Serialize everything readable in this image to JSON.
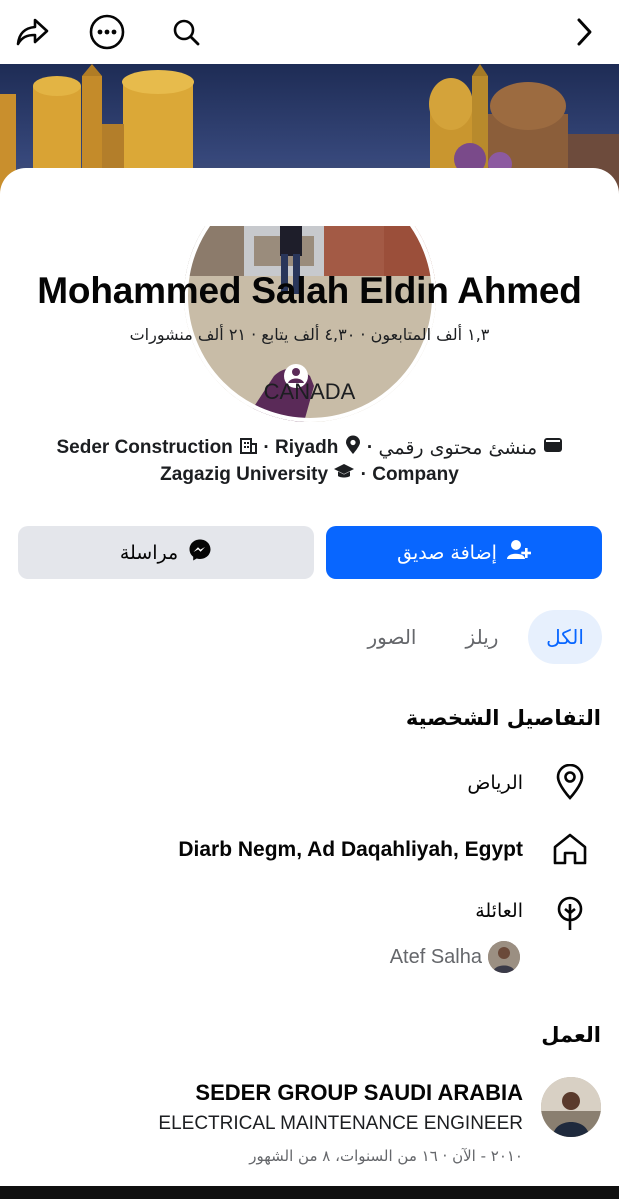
{
  "toolbar": {
    "share_icon": "share-icon",
    "more_icon": "more-dots-icon",
    "search_icon": "search-icon",
    "forward_icon": "chevron-right-icon"
  },
  "profile": {
    "name": "Mohammed Salah Eldin Ahmed",
    "stats": "١,٣ ألف المتابعون · ٤,٣٠ ألف يتابع · ٢١ ألف منشورات",
    "bio": "CANADA",
    "meta_line1": {
      "category": "منشئ محتوى رقمي",
      "location": "Riyadh",
      "workplace": "Seder Construction"
    },
    "meta_line2": {
      "education": "Zagazig University",
      "company": "Company"
    }
  },
  "actions": {
    "add_friend": "إضافة صديق",
    "message": "مراسلة"
  },
  "tabs": [
    {
      "label": "الكل",
      "active": true
    },
    {
      "label": "ريلز",
      "active": false
    },
    {
      "label": "الصور",
      "active": false
    }
  ],
  "details": {
    "title": "التفاصيل الشخصية",
    "current_city": "الرياض",
    "hometown": "Diarb Negm, Ad Daqahliyah, Egypt",
    "family_label": "العائلة",
    "family_member": "Atef Salha"
  },
  "work": {
    "title": "العمل",
    "company": "SEDER GROUP SAUDI ARABIA",
    "position": "ELECTRICAL MAINTENANCE ENGINEER",
    "duration": "٢٠١٠ - الآن · ١٦ من السنوات، ٨ من الشهور"
  },
  "colors": {
    "primary": "#0866ff",
    "active_tab_bg": "#e7f0fd",
    "secondary_button": "#e4e6eb",
    "muted_text": "#65676b",
    "profile_frame_badge": "#5a2a58"
  }
}
